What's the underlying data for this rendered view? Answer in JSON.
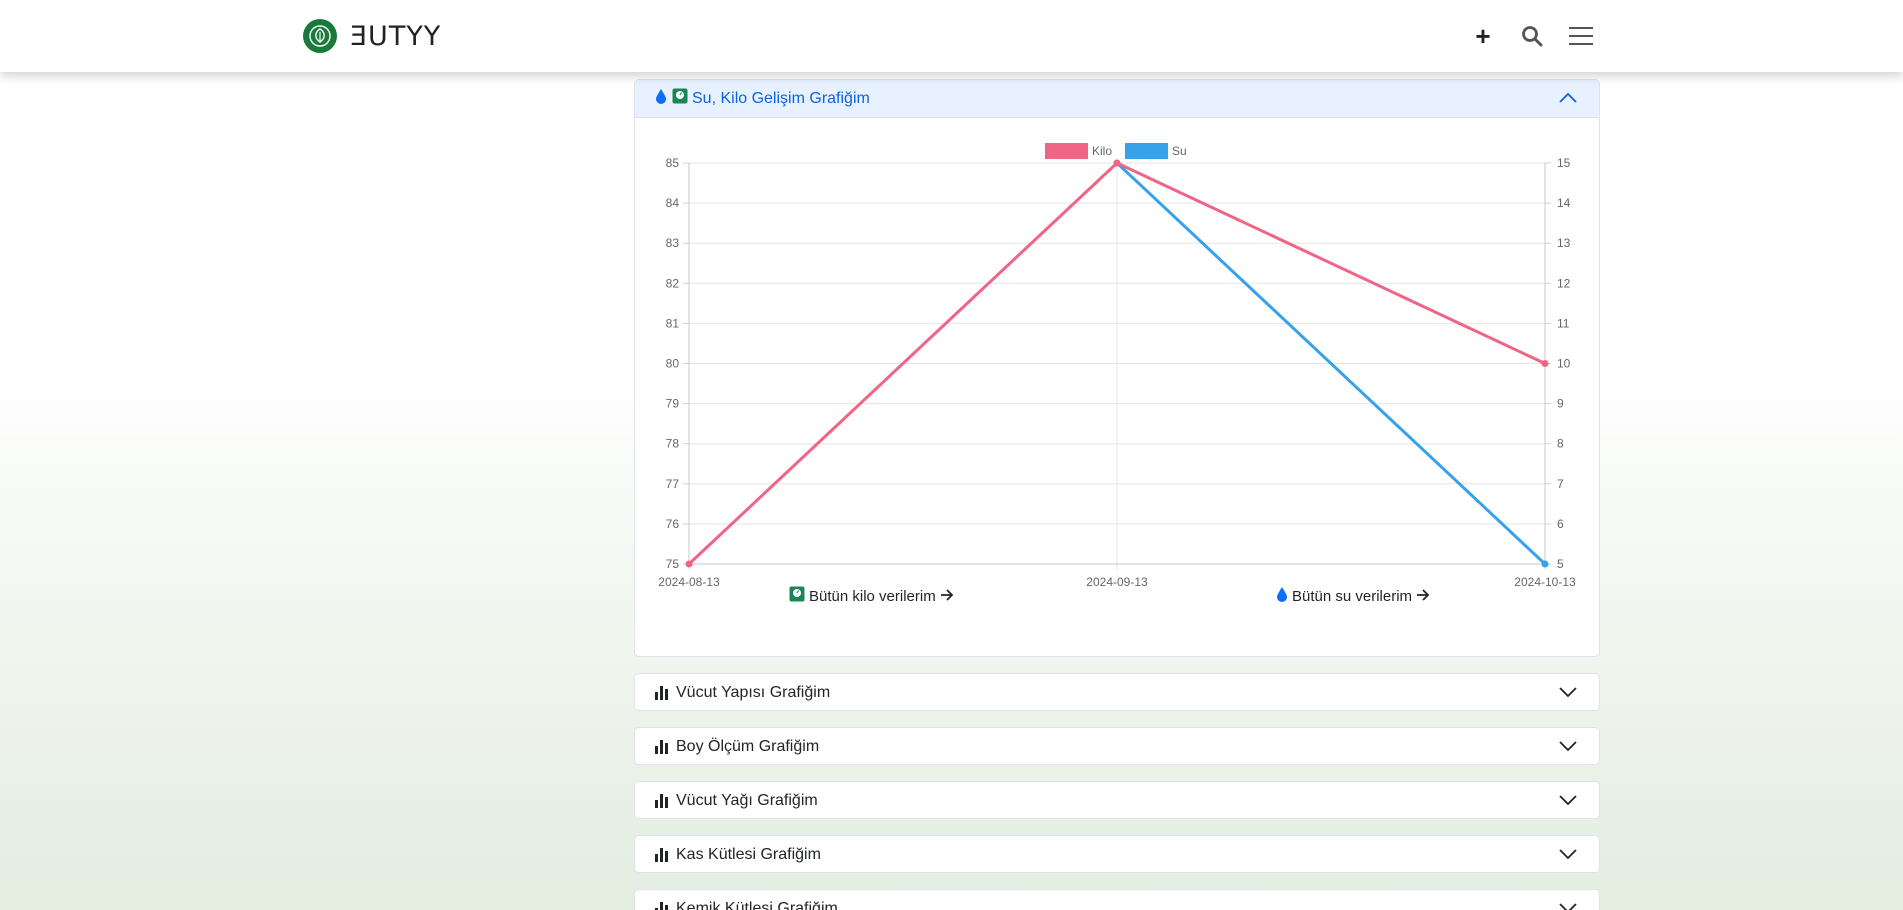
{
  "brand": {
    "name": "ƎUTYY",
    "logo_icon": "leaf-logo-icon"
  },
  "nav": {
    "add_label": "+",
    "search_icon": "search-icon",
    "menu_icon": "hamburger-menu-icon"
  },
  "accordion": {
    "open_section": {
      "title": "Su, Kilo Gelişim Grafiğim",
      "icons": [
        "water-drop-icon",
        "weight-scale-icon"
      ]
    },
    "links": {
      "kilo": "Bütün kilo verilerim",
      "su": "Bütün su verilerim"
    },
    "sections": [
      {
        "title": "Vücut Yapısı Grafiğim"
      },
      {
        "title": "Boy Ölçüm Grafiğim"
      },
      {
        "title": "Vücut Yağı Grafiğim"
      },
      {
        "title": "Kas Kütlesi Grafiğim"
      },
      {
        "title": "Kemik Kütlesi Grafiğim"
      }
    ]
  },
  "colors": {
    "kilo": "#f06485",
    "su": "#36a2eb",
    "accent": "#0c63e4",
    "brand": "#1a7a3c"
  },
  "chart_data": {
    "type": "line",
    "categories": [
      "2024-08-13",
      "2024-09-13",
      "2024-10-13"
    ],
    "series": [
      {
        "name": "Kilo",
        "values": [
          75,
          85,
          80
        ],
        "axis": "left"
      },
      {
        "name": "Su",
        "values": [
          null,
          15,
          5
        ],
        "axis": "right"
      }
    ],
    "ylim_left": [
      75,
      85
    ],
    "ylim_right": [
      5,
      15
    ],
    "left_ticks": [
      "75",
      "76",
      "77",
      "78",
      "79",
      "80",
      "81",
      "82",
      "83",
      "84",
      "85"
    ],
    "right_ticks": [
      "5",
      "6",
      "7",
      "8",
      "9",
      "10",
      "11",
      "12",
      "13",
      "14",
      "15"
    ],
    "legend_position": "top-center",
    "grid": true
  }
}
